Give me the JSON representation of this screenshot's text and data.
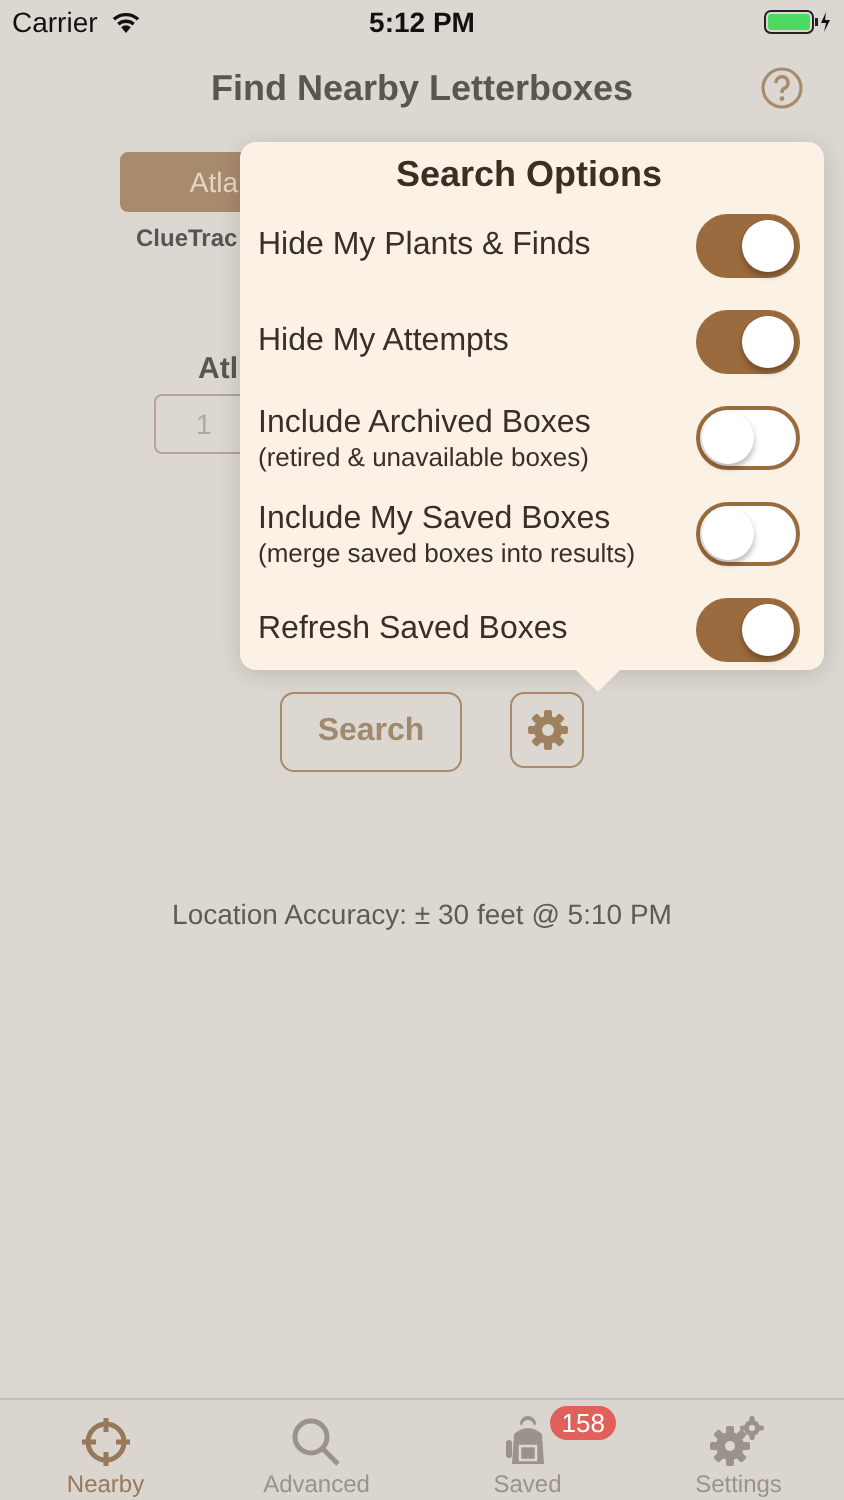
{
  "status_bar": {
    "carrier": "Carrier",
    "time": "5:12 PM"
  },
  "nav": {
    "title": "Find Nearby Letterboxes"
  },
  "segment": {
    "label": "Atla",
    "selected": true
  },
  "source_label": "ClueTrac",
  "atlas_label": "Atl",
  "atlas_field": {
    "value": "1"
  },
  "popover": {
    "title": "Search Options",
    "options": [
      {
        "label": "Hide My Plants & Finds",
        "on": true
      },
      {
        "label": "Hide My Attempts",
        "on": true
      },
      {
        "label": "Include Archived Boxes",
        "sublabel": "(retired & unavailable boxes)",
        "on": false
      },
      {
        "label": "Include My Saved Boxes",
        "sublabel": "(merge saved boxes into results)",
        "on": false
      },
      {
        "label": "Refresh Saved Boxes",
        "on": true
      }
    ]
  },
  "search_button": "Search",
  "location_accuracy": "Location Accuracy: ± 30 feet @ 5:10 PM",
  "tabs": [
    {
      "label": "Nearby",
      "selected": true
    },
    {
      "label": "Advanced",
      "selected": false
    },
    {
      "label": "Saved",
      "selected": false,
      "badge": "158"
    },
    {
      "label": "Settings",
      "selected": false
    }
  ]
}
